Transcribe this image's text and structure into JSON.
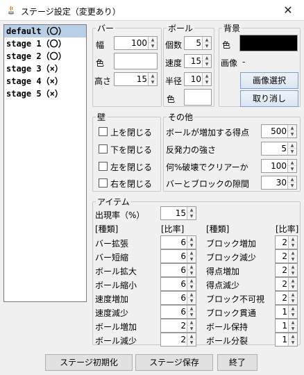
{
  "window": {
    "title": "ステージ設定（変更あり）",
    "close_glyph": "✕"
  },
  "stages": [
    "default（〇）",
    "stage 1（〇）",
    "stage 2（〇）",
    "stage 3（×）",
    "stage 4（×）",
    "stage 5（×）"
  ],
  "bar": {
    "legend": "バー",
    "width_label": "幅",
    "width_value": "100",
    "color_label": "色",
    "height_label": "高さ",
    "height_value": "15"
  },
  "ball": {
    "legend": "ボール",
    "count_label": "個数",
    "count_value": "5",
    "speed_label": "速度",
    "speed_value": "15",
    "radius_label": "半径",
    "radius_value": "10",
    "color_label": "色"
  },
  "background": {
    "legend": "背景",
    "color_label": "色",
    "image_label": "画像",
    "image_value": "-",
    "select_button": "画像選択",
    "cancel_button": "取り消し",
    "color": "#000000"
  },
  "wall": {
    "legend": "壁",
    "top": "上を閉じる",
    "bottom": "下を閉じる",
    "left": "左を閉じる",
    "right": "右を閉じる"
  },
  "other": {
    "legend": "その他",
    "rows": [
      {
        "label": "ボールが増加する得点",
        "value": "500"
      },
      {
        "label": "反発力の強さ",
        "value": "5"
      },
      {
        "label": "何%破壊でクリアーか",
        "value": "100"
      },
      {
        "label": "バーとブロックの隙間",
        "value": "30"
      }
    ]
  },
  "items": {
    "legend": "アイテム",
    "rate_label": "出現率（%）",
    "rate_value": "15",
    "kind_header": "[種類]",
    "ratio_header": "[比率]",
    "left": [
      {
        "label": "バー拡張",
        "value": "6"
      },
      {
        "label": "バー短縮",
        "value": "6"
      },
      {
        "label": "ボール拡大",
        "value": "6"
      },
      {
        "label": "ボール縮小",
        "value": "6"
      },
      {
        "label": "速度増加",
        "value": "6"
      },
      {
        "label": "速度減少",
        "value": "6"
      },
      {
        "label": "ボール増加",
        "value": "2"
      },
      {
        "label": "ボール減少",
        "value": "2"
      }
    ],
    "right": [
      {
        "label": "ブロック増加",
        "value": "2"
      },
      {
        "label": "ブロック減少",
        "value": "2"
      },
      {
        "label": "得点増加",
        "value": "2"
      },
      {
        "label": "得点減少",
        "value": "2"
      },
      {
        "label": "ブロック不可視",
        "value": "2"
      },
      {
        "label": "ブロック貫通",
        "value": "1"
      },
      {
        "label": "ボール保持",
        "value": "1"
      },
      {
        "label": "ボール分裂",
        "value": "1"
      }
    ]
  },
  "footer": {
    "init_button": "ステージ初期化",
    "save_button": "ステージ保存",
    "exit_button": "終了"
  }
}
